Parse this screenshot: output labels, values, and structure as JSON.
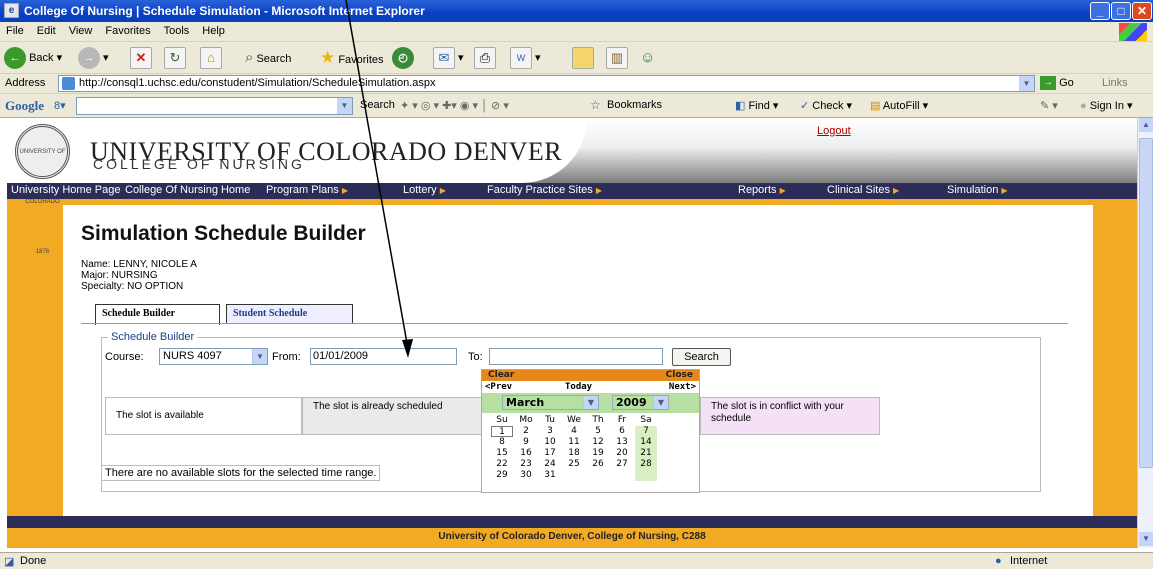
{
  "window": {
    "title": "College Of Nursing | Schedule Simulation - Microsoft Internet Explorer",
    "minimize": "_",
    "maximize": "□",
    "close": "✕"
  },
  "menubar": [
    "File",
    "Edit",
    "View",
    "Favorites",
    "Tools",
    "Help"
  ],
  "toolbar": {
    "back": "Back",
    "search": "Search",
    "favorites": "Favorites"
  },
  "address": {
    "label": "Address",
    "url": "http://consql1.uchsc.edu/constudent/Simulation/ScheduleSimulation.aspx",
    "go": "Go",
    "links": "Links"
  },
  "googlebar": {
    "logo": "Google",
    "search": "Search",
    "bookmarks": "Bookmarks",
    "find": "Find",
    "check": "Check",
    "autofill": "AutoFill",
    "signin": "Sign In"
  },
  "site": {
    "university": "UNIVERSITY OF COLORADO DENVER",
    "college": "COLLEGE OF NURSING",
    "seal_text": "UNIVERSITY OF COLORADO 1876",
    "logout": "Logout",
    "nav": [
      "University Home Page",
      "College Of Nursing Home",
      "Program Plans",
      "Lottery",
      "Faculty Practice Sites",
      "Reports",
      "Clinical Sites",
      "Simulation"
    ],
    "footer": "University of Colorado Denver, College of Nursing, C288"
  },
  "content": {
    "title": "Simulation Schedule Builder",
    "name": "Name: LENNY, NICOLE A",
    "major": "Major: NURSING",
    "specialty": "Specialty: NO OPTION",
    "tabs": [
      "Schedule Builder",
      "Student Schedule"
    ],
    "legend": "Schedule Builder",
    "course_label": "Course:",
    "course_value": "NURS 4097",
    "from_label": "From:",
    "from_value": "01/01/2009",
    "to_label": "To:",
    "to_value": "",
    "search": "Search",
    "slot_available": "The slot is available",
    "slot_scheduled": "The slot is already scheduled",
    "slot_conflict": "The slot is in conflict with your schedule",
    "no_slots": "There are no available slots for the selected time range."
  },
  "calendar": {
    "clear": "Clear",
    "close": "Close",
    "prev": "<Prev",
    "today": "Today",
    "next": "Next>",
    "month": "March",
    "year": "2009",
    "days": [
      "Su",
      "Mo",
      "Tu",
      "We",
      "Th",
      "Fr",
      "Sa"
    ],
    "weeks": [
      [
        "1",
        "2",
        "3",
        "4",
        "5",
        "6",
        "7"
      ],
      [
        "8",
        "9",
        "10",
        "11",
        "12",
        "13",
        "14"
      ],
      [
        "15",
        "16",
        "17",
        "18",
        "19",
        "20",
        "21"
      ],
      [
        "22",
        "23",
        "24",
        "25",
        "26",
        "27",
        "28"
      ],
      [
        "29",
        "30",
        "31",
        "",
        "",
        "",
        ""
      ]
    ]
  },
  "status": {
    "left": "Done",
    "right": "Internet"
  },
  "colors": {
    "ie_blue": "#0a3fc4",
    "ui_beige": "#ece9d8",
    "page_gold": "#f2aa25",
    "nav_navy": "#2c2c58",
    "cal_orange": "#e8881a",
    "cal_green": "#b6dfa2",
    "cal_weekend": "#d8efc4",
    "conflict_pink": "#f5e1f5"
  }
}
